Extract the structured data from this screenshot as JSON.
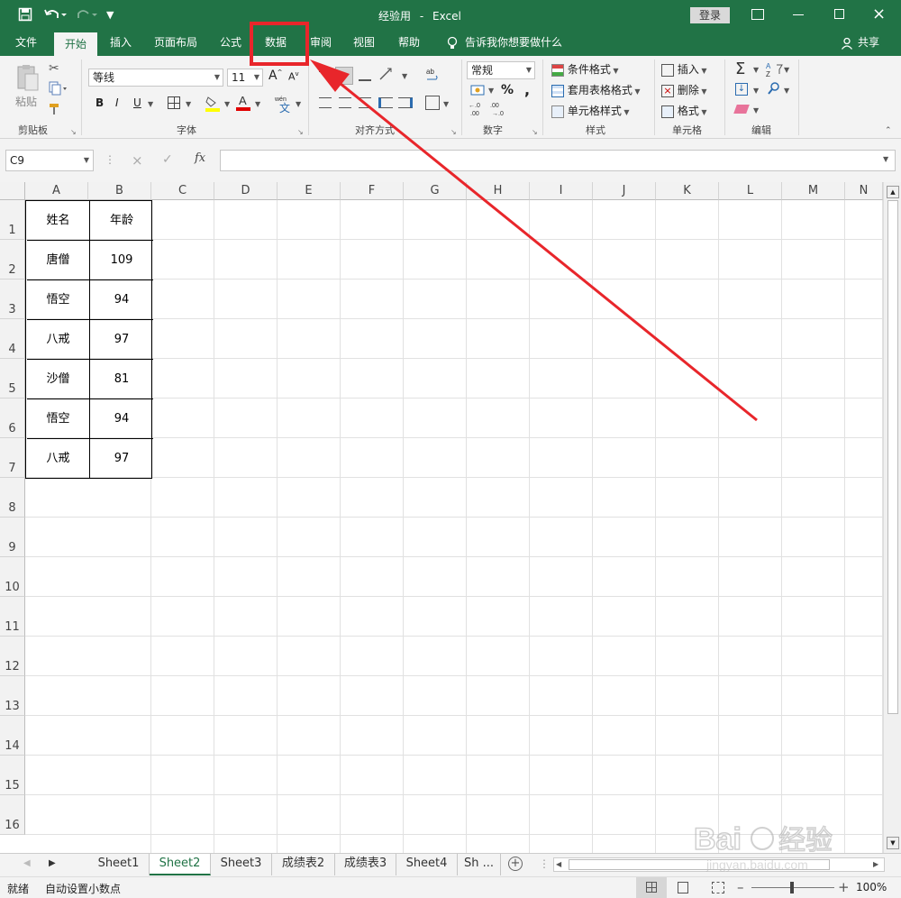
{
  "title": {
    "doc": "经验用",
    "sep": "-",
    "app": "Excel",
    "login": "登录"
  },
  "tabs": [
    "文件",
    "开始",
    "插入",
    "页面布局",
    "公式",
    "数据",
    "审阅",
    "视图",
    "帮助"
  ],
  "tell_me": "告诉我你想要做什么",
  "share": "共享",
  "ribbon": {
    "paste": "粘贴",
    "clipboard": "剪贴板",
    "font_name": "等线",
    "font_size": "11",
    "bold": "B",
    "italic": "I",
    "underline": "U",
    "font_group": "字体",
    "align_group": "对齐方式",
    "number_format": "常规",
    "percent": "%",
    "comma": ",",
    "number_group": "数字",
    "cond_format": "条件格式",
    "table_format": "套用表格格式",
    "cell_style": "单元格样式",
    "style_group": "样式",
    "insert": "插入",
    "delete": "删除",
    "format": "格式",
    "cells_group": "单元格",
    "edit_group": "编辑"
  },
  "formula_bar": {
    "name_box": "C9",
    "fx": "fx",
    "value": ""
  },
  "grid": {
    "columns": [
      "A",
      "B",
      "C",
      "D",
      "E",
      "F",
      "G",
      "H",
      "I",
      "J",
      "K",
      "L",
      "M",
      "N"
    ],
    "rows": [
      "1",
      "2",
      "3",
      "4",
      "5",
      "6",
      "7",
      "8",
      "9",
      "10",
      "11",
      "12",
      "13",
      "14",
      "15",
      "16"
    ],
    "table": {
      "header": [
        "姓名",
        "年龄"
      ],
      "rows": [
        [
          "唐僧",
          "109"
        ],
        [
          "悟空",
          "94"
        ],
        [
          "八戒",
          "97"
        ],
        [
          "沙僧",
          "81"
        ],
        [
          "悟空",
          "94"
        ],
        [
          "八戒",
          "97"
        ]
      ]
    }
  },
  "sheets": [
    "Sheet1",
    "Sheet2",
    "Sheet3",
    "成绩表2",
    "成绩表3",
    "Sheet4",
    "Sh ..."
  ],
  "active_sheet": "Sheet2",
  "status": {
    "ready": "就绪",
    "auto_decimal": "自动设置小数点",
    "zoom": "100%"
  },
  "colors": {
    "excel_green": "#217346",
    "highlight": "#e8262b"
  }
}
